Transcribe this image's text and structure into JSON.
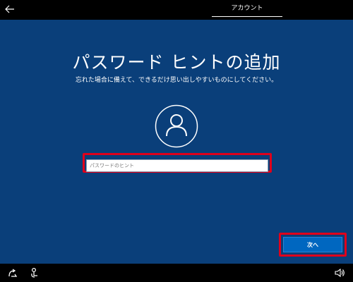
{
  "header": {
    "tab_label": "アカウント",
    "back_icon": "back-arrow-icon"
  },
  "main": {
    "title": "パスワード ヒントの追加",
    "subtitle": "忘れた場合に備えて、できるだけ思い出しやすいものにしてください。",
    "avatar_icon": "user-avatar-icon",
    "hint_input": {
      "placeholder": "パスワードのヒント",
      "value": ""
    },
    "next_button_label": "次へ"
  },
  "footer": {
    "icons": [
      "ease-of-access-icon",
      "accessibility-icon",
      "volume-icon"
    ]
  },
  "colors": {
    "background": "#0a3f7a",
    "bars": "#000000",
    "button": "#0067c0",
    "highlight": "#e0001b"
  }
}
